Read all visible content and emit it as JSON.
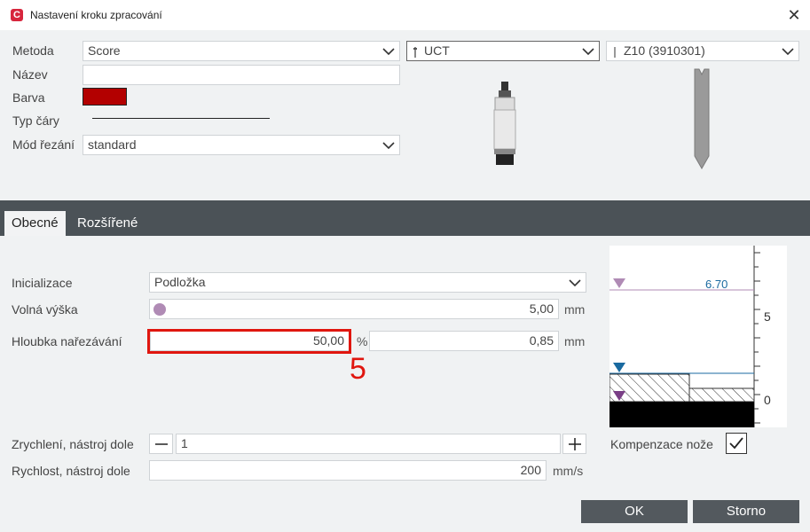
{
  "window": {
    "title": "Nastavení kroku zpracování",
    "logo_letter": "C"
  },
  "top": {
    "method_label": "Metoda",
    "method_value": "Score",
    "tool_value": "UCT",
    "blade_value": "Z10 (3910301)",
    "name_label": "Název",
    "name_value": "",
    "color_label": "Barva",
    "color_value": "#b30000",
    "line_type_label": "Typ čáry",
    "cut_mode_label": "Mód řezání",
    "cut_mode_value": "standard"
  },
  "tabs": [
    {
      "label": "Obecné",
      "active": true
    },
    {
      "label": "Rozšířené",
      "active": false
    }
  ],
  "general": {
    "init_label": "Inicializace",
    "init_value": "Podložka",
    "free_height_label": "Volná výška",
    "free_height_value": "5,00",
    "free_height_unit": "mm",
    "depth_label": "Hloubka nařezávání",
    "depth_percent_value": "50,00",
    "depth_percent_unit": "%",
    "depth_mm_value": "0,85",
    "depth_mm_unit": "mm",
    "step_marker": "5",
    "accel_label": "Zrychlení, nástroj dole",
    "accel_value": "1",
    "speed_label": "Rychlost, nástroj dole",
    "speed_value": "200",
    "speed_unit": "mm/s",
    "comp_label": "Kompenzace nože",
    "comp_checked": true
  },
  "diagram": {
    "height_label": "6.70",
    "tick_5": "5",
    "tick_0": "0"
  },
  "footer": {
    "ok_label": "OK",
    "cancel_label": "Storno"
  },
  "colors": {
    "accent_red": "#e0160f",
    "tab_bar": "#4b5257",
    "button": "#53595e",
    "marker_purple": "#b08bb5",
    "marker_blue": "#1a6aa0"
  }
}
